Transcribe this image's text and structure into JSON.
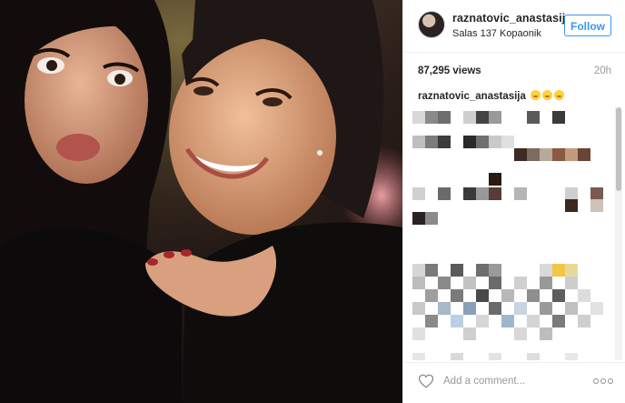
{
  "post": {
    "username": "raznatovic_anastasija",
    "location": "Salas 137 Kopaonik",
    "follow_label": "Follow",
    "views": "87,295 views",
    "time_ago": "20h"
  },
  "caption": {
    "username": "raznatovic_anastasija",
    "emojis": [
      "flushed-kiss-emoji",
      "flushed-kiss-emoji",
      "flushed-kiss-emoji"
    ]
  },
  "comment_box": {
    "placeholder": "Add a comment..."
  },
  "colors": {
    "accent": "#3897f0",
    "text": "#262626",
    "muted": "#999999",
    "border": "#efefef"
  }
}
